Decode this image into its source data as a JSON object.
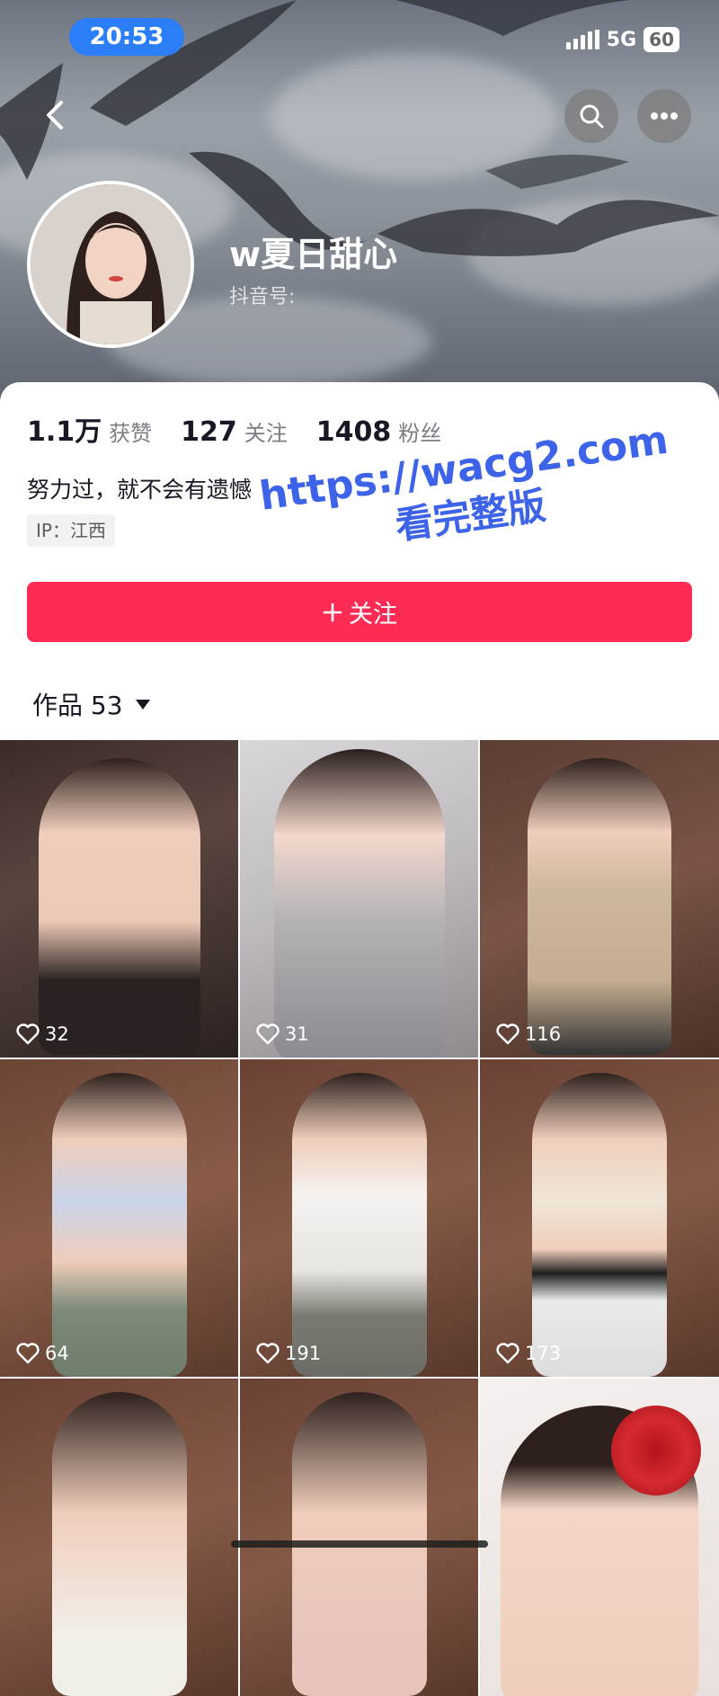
{
  "status_bar": {
    "time": "20:53",
    "network": "5G",
    "battery": "60"
  },
  "profile": {
    "nickname": "w夏日甜心",
    "account_label": "抖音号:",
    "stats": [
      {
        "value": "1.1万",
        "label": "获赞"
      },
      {
        "value": "127",
        "label": "关注"
      },
      {
        "value": "1408",
        "label": "粉丝"
      }
    ],
    "bio": "努力过，就不会有遗憾",
    "ip": "IP：江西"
  },
  "watermark": {
    "line1": "https://wacg2.com",
    "line2": "看完整版"
  },
  "follow_button": {
    "label": "关注"
  },
  "works_tab": {
    "label": "作品 53"
  },
  "videos": [
    {
      "likes": "32"
    },
    {
      "likes": "31"
    },
    {
      "likes": "116"
    },
    {
      "likes": "64"
    },
    {
      "likes": "191"
    },
    {
      "likes": "173"
    },
    {
      "likes": ""
    },
    {
      "likes": ""
    },
    {
      "likes": ""
    }
  ],
  "colors": {
    "accent": "#fe2c55",
    "status_pill": "#2c7ef8",
    "watermark": "#3d63e8"
  },
  "icons": {
    "back": "chevron-left-icon",
    "search": "search-icon",
    "more": "more-dots-icon",
    "like": "heart-outline-icon"
  }
}
